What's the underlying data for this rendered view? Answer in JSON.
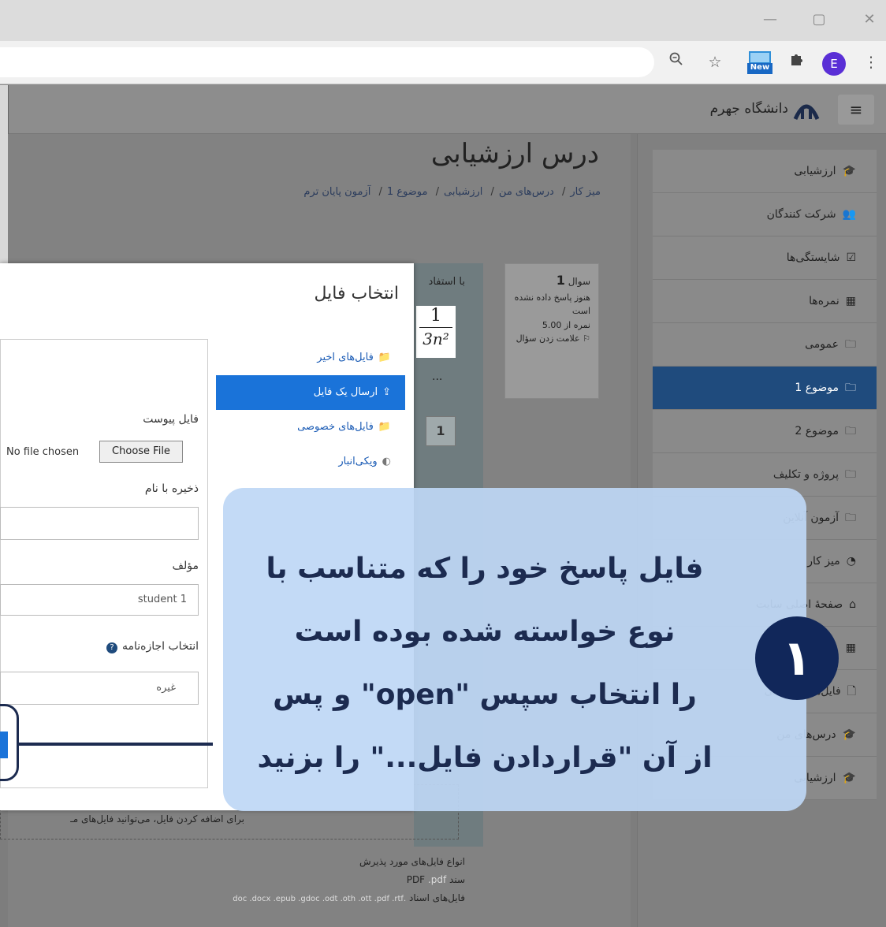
{
  "browser": {
    "window_buttons": [
      "—",
      "▢",
      "✕"
    ],
    "zoom_icon": "zoom-icon",
    "star_icon": "star-icon",
    "extension_badge": "New",
    "puzzle_icon": "puzzle-icon",
    "profile_initial": "E",
    "menu_icon": "⋮"
  },
  "header": {
    "menu_icon": "≡",
    "brand": "دانشگاه جهرم"
  },
  "page": {
    "title": "درس ارزشیابی",
    "breadcrumb": [
      "میز کار",
      "درس‌های من",
      "ارزشیابی",
      "موضوع 1",
      "آزمون پایان ترم"
    ]
  },
  "sidebar": {
    "items": [
      {
        "label": "ارزشیابی",
        "icon": "🎓",
        "active": false
      },
      {
        "label": "شرکت کنندگان",
        "icon": "👥",
        "active": false
      },
      {
        "label": "شایستگی‌ها",
        "icon": "☑",
        "active": false
      },
      {
        "label": "نمره‌ها",
        "icon": "▦",
        "active": false
      },
      {
        "label": "عمومی",
        "icon": "🗀",
        "active": false
      },
      {
        "label": "موضوع 1",
        "icon": "🗀",
        "active": true
      },
      {
        "label": "موضوع 2",
        "icon": "🗀",
        "active": false
      },
      {
        "label": "پروژه و تکلیف",
        "icon": "🗀",
        "active": false
      },
      {
        "label": "آزمون آنلاین",
        "icon": "🗀",
        "active": false
      },
      {
        "label": "میز کار",
        "icon": "◔",
        "active": false
      },
      {
        "label": "صفحهٔ اصلی سایت",
        "icon": "⌂",
        "active": false
      },
      {
        "label": "",
        "icon": "▦",
        "active": false
      },
      {
        "label": "فایل‌های شخصی",
        "icon": "🗋",
        "active": false
      },
      {
        "label": "درس‌های من",
        "icon": "🎓",
        "active": false
      },
      {
        "label": "ارزشیابی",
        "icon": "🎓",
        "active": false
      }
    ]
  },
  "question": {
    "label": "سوال",
    "number": "1",
    "status": "هنوز پاسخ داده نشده است",
    "grade": "نمره از 5.00",
    "flag": "علامت زدن سؤال",
    "text_partial": "با استفاد",
    "formula_num": "1",
    "formula_den": "3n²",
    "ellipsis": "...",
    "step_box": "1"
  },
  "file_picker": {
    "title": "انتخاب فایل",
    "repositories": [
      {
        "label": "فایل‌های اخیر",
        "icon": "folder-icon",
        "active": false
      },
      {
        "label": "ارسال یک فایل",
        "icon": "upload-icon",
        "active": true
      },
      {
        "label": "فایل‌های خصوصی",
        "icon": "folder-icon",
        "active": false
      },
      {
        "label": "ویکی‌انبار",
        "icon": "wiki-icon",
        "active": false
      }
    ],
    "attachment_label": "فایل پیوست",
    "no_file_text": "No file chosen",
    "choose_button": "Choose File",
    "save_as_label": "ذخیره با نام",
    "save_as_value": "",
    "author_label": "مؤلف",
    "author_value": "student 1",
    "license_label": "انتخاب اجازه‌نامه",
    "license_value": "غیره"
  },
  "drop_area": {
    "hint": "برای اضافه کردن فایل، می‌توانید فایل‌های مـ"
  },
  "accepted_types": {
    "heading": "انواع فایل‌های مورد پذیرش",
    "pdf": "سند PDF",
    "pdf_ext": ".pdf",
    "docs_label": "فایل‌های اسناد",
    "docs_ext": ".doc .docx .epub .gdoc .odt .oth .ott .pdf .rtf"
  },
  "overlay": {
    "step_number": "۱",
    "lines": [
      "فایل پاسخ خود را که متناسب با",
      "نوع خواسته شده بوده است",
      "را انتخاب سپس \"open\" و پس",
      "از آن \"قراردادن فایل...\" را بزنید"
    ]
  },
  "colors": {
    "accent": "#1a73d9",
    "nav_active": "#1f4b7d",
    "overlay_bg": "#bed7f5",
    "overlay_text": "#1c2b50",
    "step_circle": "#11275a"
  }
}
